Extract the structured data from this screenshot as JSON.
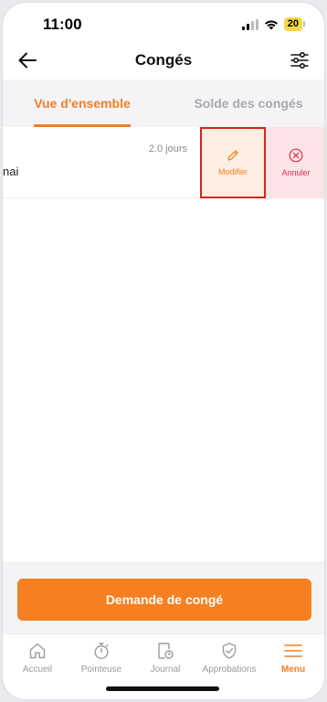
{
  "status_bar": {
    "time": "11:00",
    "battery": "20"
  },
  "header": {
    "title": "Congés"
  },
  "tabs": [
    {
      "label": "Vue d'ensemble",
      "active": true
    },
    {
      "label": "Solde des congés",
      "active": false
    }
  ],
  "leave_row": {
    "days": "2.0 jours",
    "label_fragment": "nai",
    "modify_label": "Modifier",
    "cancel_label": "Annuler"
  },
  "request_button": {
    "label": "Demande de congé"
  },
  "bottom_nav": [
    {
      "label": "Accueil",
      "icon": "home-icon",
      "active": false
    },
    {
      "label": "Pointeuse",
      "icon": "stopwatch-icon",
      "active": false
    },
    {
      "label": "Journal",
      "icon": "journal-icon",
      "active": false
    },
    {
      "label": "Approbations",
      "icon": "shield-check-icon",
      "active": false
    },
    {
      "label": "Menu",
      "icon": "menu-icon",
      "active": true
    }
  ],
  "colors": {
    "accent": "#f47e22",
    "danger": "#d9304f",
    "highlight_border": "#e0201c"
  }
}
